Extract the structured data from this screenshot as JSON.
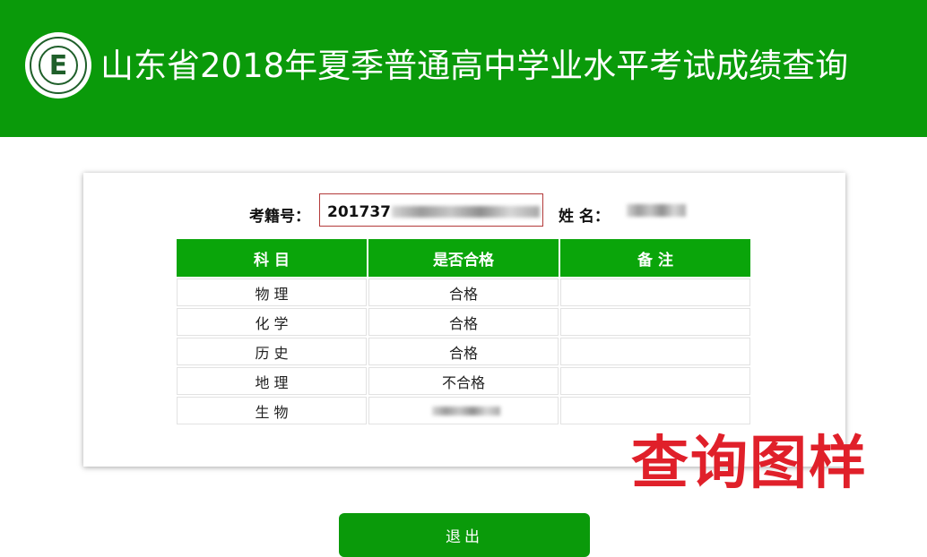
{
  "header": {
    "title": "山东省2018年夏季普通高中学业水平考试成绩查询",
    "logo": {
      "icon": "shandong-exam-logo",
      "letter": "E"
    },
    "bg_color": "#0a9a0a"
  },
  "info": {
    "exam_no_label": "考籍号：",
    "exam_no_value": "201737",
    "name_label": "姓 名："
  },
  "table": {
    "headers": [
      "科 目",
      "是否合格",
      "备 注"
    ],
    "rows": [
      {
        "subject": "物 理",
        "result": "合格",
        "note": ""
      },
      {
        "subject": "化 学",
        "result": "合格",
        "note": ""
      },
      {
        "subject": "历 史",
        "result": "合格",
        "note": ""
      },
      {
        "subject": "地 理",
        "result": "不合格",
        "note": ""
      },
      {
        "subject": "生 物",
        "result": "",
        "note": ""
      }
    ]
  },
  "watermark": {
    "text": "查询图样",
    "color": "#e0202a"
  },
  "exit_button": {
    "label": "退出"
  }
}
